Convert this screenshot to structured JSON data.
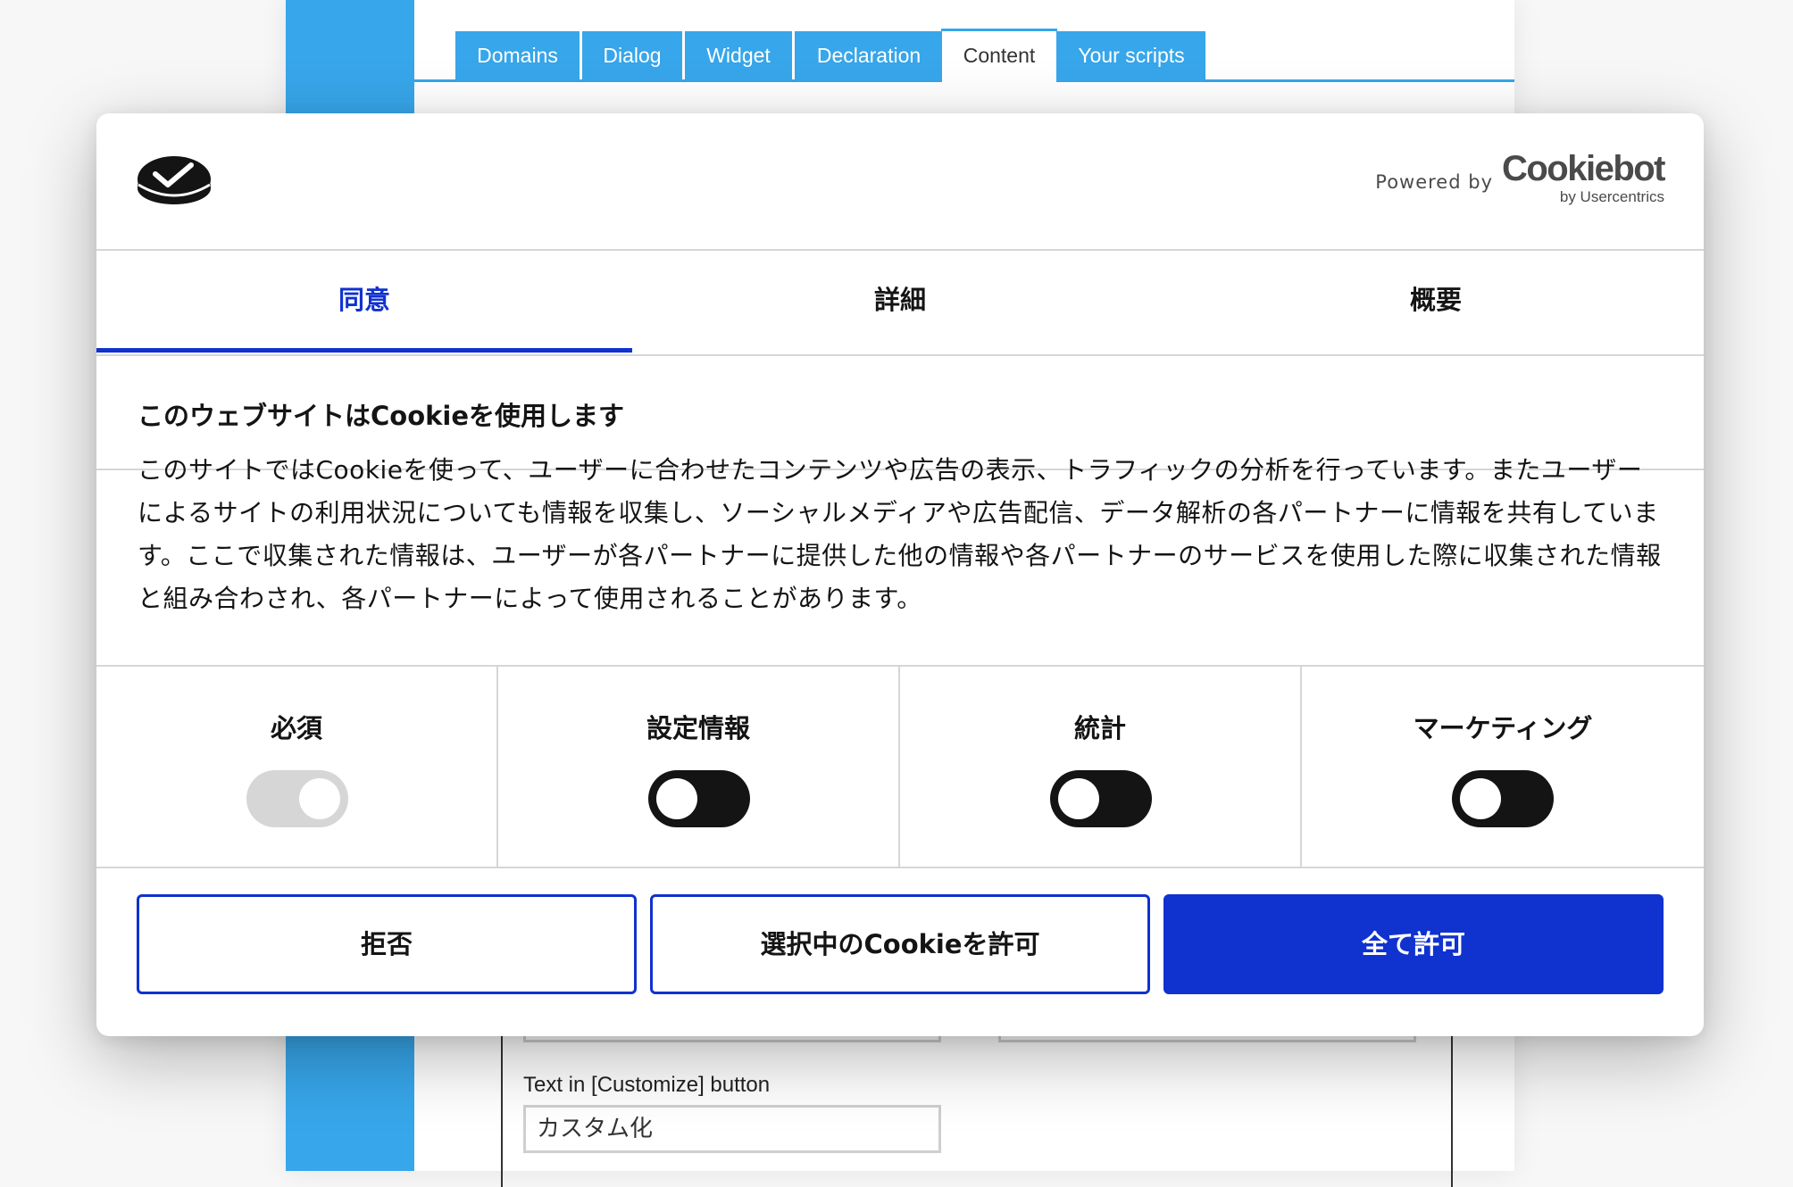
{
  "background": {
    "tabs": [
      {
        "label": "Domains"
      },
      {
        "label": "Dialog"
      },
      {
        "label": "Widget"
      },
      {
        "label": "Declaration"
      },
      {
        "label": "Content",
        "active": true
      },
      {
        "label": "Your scripts"
      }
    ],
    "field_label": "Text in [Customize] button",
    "field_value": "カスタム化"
  },
  "dialog": {
    "powered_by": "Powered by",
    "brand_name": "Cookiebot",
    "brand_sub": "by Usercentrics",
    "tabs": [
      {
        "label": "同意",
        "active": true
      },
      {
        "label": "詳細"
      },
      {
        "label": "概要"
      }
    ],
    "title": "このウェブサイトはCookieを使用します",
    "body": "このサイトではCookieを使って、ユーザーに合わせたコンテンツや広告の表示、トラフィックの分析を行っています。またユーザーによるサイトの利用状況についても情報を収集し、ソーシャルメディアや広告配信、データ解析の各パートナーに情報を共有しています。ここで収集された情報は、ユーザーが各パートナーに提供した他の情報や各パートナーのサービスを使用した際に収集された情報と組み合わされ、各パートナーによって使用されることがあります。",
    "toggles": [
      {
        "label": "必須",
        "state": "on",
        "disabled": true
      },
      {
        "label": "設定情報",
        "state": "off"
      },
      {
        "label": "統計",
        "state": "off"
      },
      {
        "label": "マーケティング",
        "state": "off"
      }
    ],
    "buttons": {
      "deny": "拒否",
      "allow_selection": "選択中のCookieを許可",
      "allow_all": "全て許可"
    }
  },
  "colors": {
    "accent": "#1032cf",
    "sidebar": "#37a6ea",
    "toggle_off": "#141414",
    "toggle_disabled": "#d6d6d6"
  }
}
